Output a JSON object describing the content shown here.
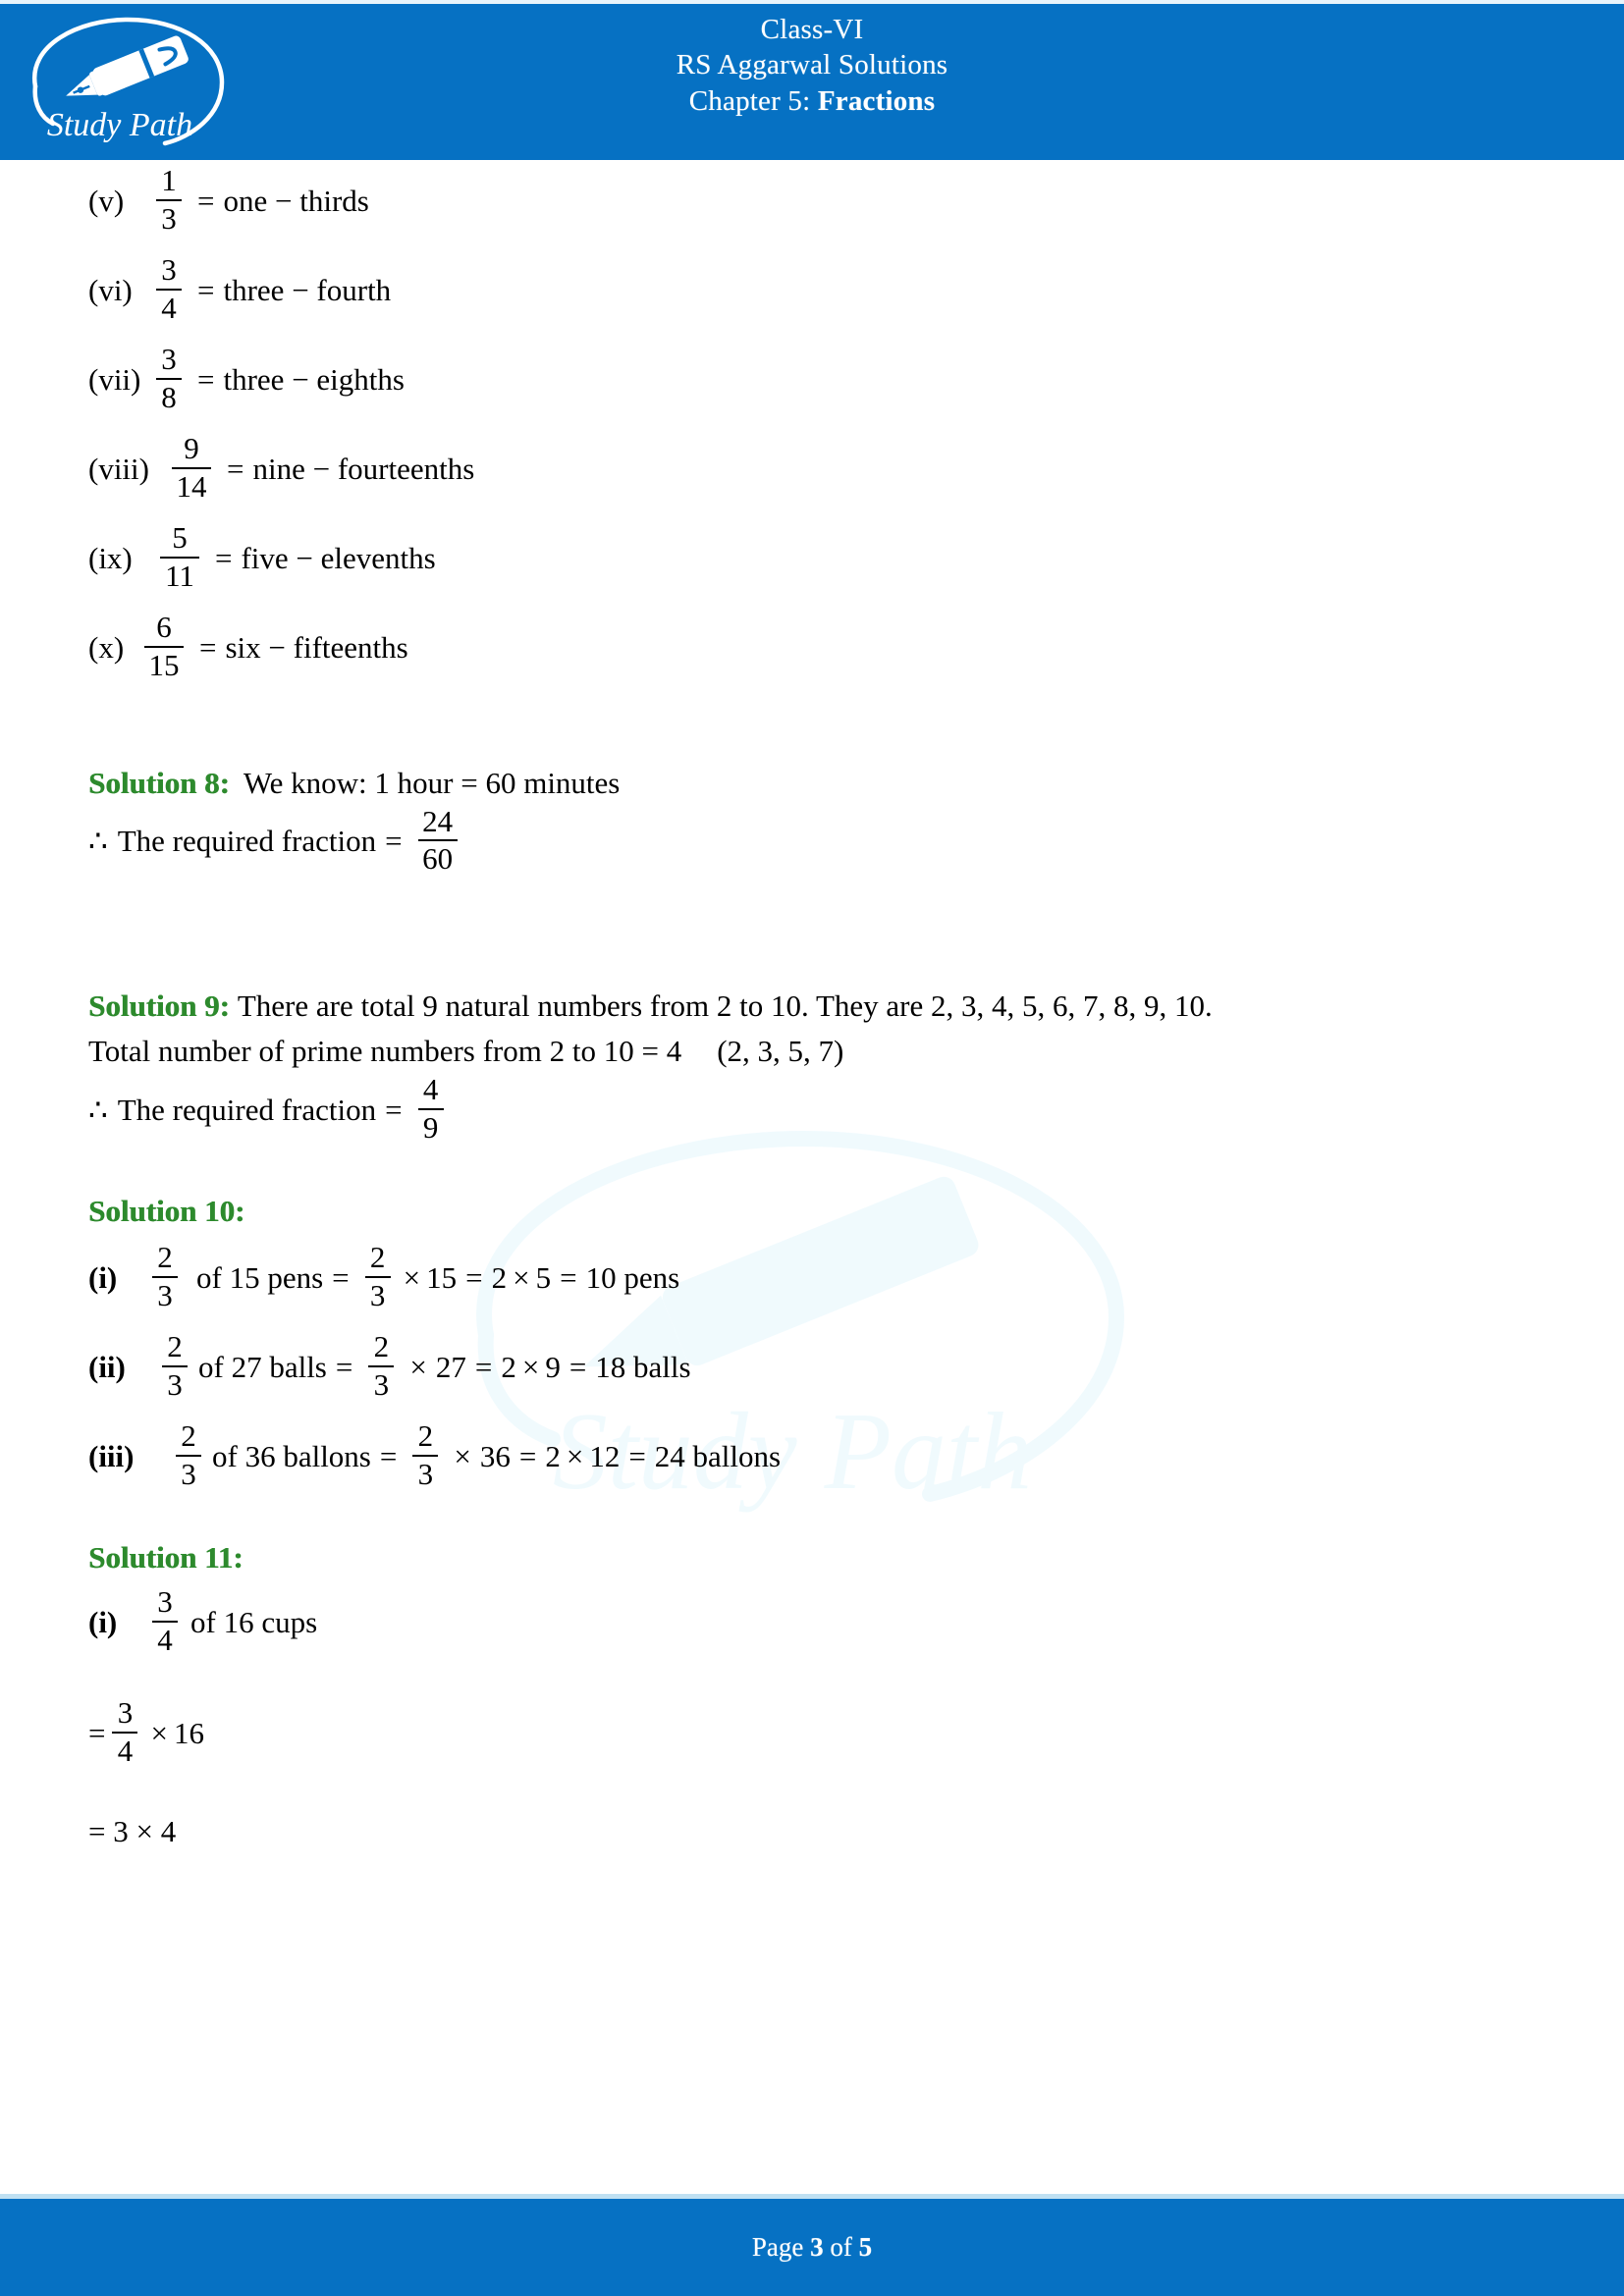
{
  "header": {
    "logo_name": "Study Path",
    "class_line": "Class-VI",
    "book_line": "RS Aggarwal Solutions",
    "chapter_label": "Chapter 5: ",
    "chapter_name": "Fractions",
    "bg_color": "#0671C3"
  },
  "watermark": {
    "text": "Study Path",
    "color": "#E3F6FC"
  },
  "fraction_list": [
    {
      "label": "(v)",
      "num": "1",
      "den": "3",
      "eq": "=",
      "words": "one − thirds"
    },
    {
      "label": "(vi)",
      "num": "3",
      "den": "4",
      "eq": "=",
      "words": "three − fourth"
    },
    {
      "label": "(vii)",
      "num": "3",
      "den": "8",
      "eq": "=",
      "words": "three − eighths"
    },
    {
      "label": "(viii)",
      "num": "9",
      "den": "14",
      "eq": "=",
      "words": "nine − fourteenths"
    },
    {
      "label": "(ix)",
      "num": "5",
      "den": "11",
      "eq": "=",
      "words": "five − elevenths"
    },
    {
      "label": "(x)",
      "num": "6",
      "den": "15",
      "eq": "=",
      "words": "six − fifteenths"
    }
  ],
  "solution8": {
    "heading": "Solution 8:",
    "statement": "We know: 1 hour = 60 minutes",
    "therefore_symbol": "∴",
    "result_label": "The required fraction",
    "eq": "=",
    "num": "24",
    "den": "60"
  },
  "solution9": {
    "heading": "Solution 9:",
    "line1": "There are total 9 natural numbers from 2 to 10. They are 2, 3, 4, 5, 6, 7, 8, 9, 10.",
    "line2": "Total number of prime numbers from 2 to 10 = 4",
    "line2_primes": "(2, 3, 5, 7)",
    "therefore_symbol": "∴",
    "result_label": "The required fraction",
    "eq": "=",
    "num": "4",
    "den": "9"
  },
  "solution10": {
    "heading": "Solution 10:",
    "items": [
      {
        "label": "(i)",
        "num": "2",
        "den": "3",
        "of_text": "of 15 pens",
        "eq1": "=",
        "num2": "2",
        "den2": "3",
        "times1": "×",
        "factor": "15",
        "eq2": "=",
        "a": "2",
        "times2": "×",
        "b": "5",
        "eq3": "=",
        "answer": "10 pens"
      },
      {
        "label": "(ii)",
        "num": "2",
        "den": "3",
        "of_text": "of 27 balls",
        "eq1": "=",
        "num2": "2",
        "den2": "3",
        "times1": "×",
        "factor": "27",
        "eq2": "=",
        "a": "2",
        "times2": "×",
        "b": "9",
        "eq3": "=",
        "answer": "18 balls"
      },
      {
        "label": "(iii)",
        "num": "2",
        "den": "3",
        "of_text": "of 36 ballons",
        "eq1": "=",
        "num2": "2",
        "den2": "3",
        "times1": "×",
        "factor": "36",
        "eq2": "=",
        "a": "2",
        "times2": "×",
        "b": "12",
        "eq3": "=",
        "answer": "24 ballons"
      }
    ]
  },
  "solution11": {
    "heading": "Solution 11:",
    "item_label": "(i)",
    "num": "3",
    "den": "4",
    "of_text": "of 16 cups",
    "step1_eq": "=",
    "step1_num": "3",
    "step1_den": "4",
    "step1_times": "×",
    "step1_factor": "16",
    "step2": "= 3 × 4"
  },
  "footer": {
    "page_prefix": "Page ",
    "page_current": "3",
    "page_middle": " of ",
    "page_total": "5",
    "bg_color": "#0671C3"
  }
}
